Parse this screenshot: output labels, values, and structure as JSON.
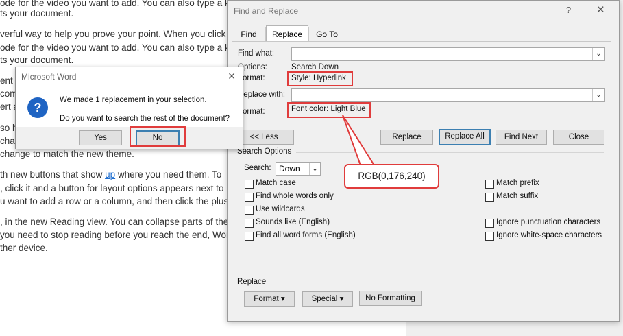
{
  "document": {
    "lines": [
      "ode for the video you want to add. You can also type a k",
      "ts your document.",
      "verful way to help you prove your point. When you click",
      "ode for the video you want to add. You can also type a k",
      "ts your document.",
      "ent",
      "com",
      "ert a",
      "so h",
      "chan",
      "change to match the new theme.",
      "th new buttons that show",
      "where you need them. To",
      ", click it and a button for layout options appears next to",
      "u want to add a row or a column, and then click the plus",
      ", in the new Reading view. You can collapse parts of the",
      "you need to stop reading before you reach the end, Wor",
      "ther device."
    ],
    "link_word": "up"
  },
  "find_replace": {
    "title": "Find and Replace",
    "help": "?",
    "close": "✕",
    "tabs": [
      "Find",
      "Replace",
      "Go To"
    ],
    "find_what_label": "Find what:",
    "find_what_value": "",
    "options_label": "Options:",
    "options_value": "Search Down",
    "format_label_1": "Format:",
    "format_value_1": "Style: Hyperlink",
    "replace_with_label": "Replace with:",
    "replace_with_value": "",
    "format_label_2": "Format:",
    "format_value_2": "Font color: Light Blue",
    "buttons": {
      "less": "<< Less",
      "replace": "Replace",
      "replace_all": "Replace All",
      "find_next": "Find Next",
      "close": "Close"
    },
    "search_options_label": "Search Options",
    "search_label": "Search:",
    "search_value": "Down",
    "checkboxes_left": [
      "Match case",
      "Find whole words only",
      "Use wildcards",
      "Sounds like (English)",
      "Find all word forms (English)"
    ],
    "checkboxes_right": [
      "Match prefix",
      "Match suffix",
      "Ignore punctuation characters",
      "Ignore white-space characters"
    ],
    "replace_section_label": "Replace",
    "format_button": "Format",
    "special_button": "Special",
    "no_formatting_button": "No Formatting"
  },
  "message_box": {
    "title": "Microsoft Word",
    "close": "✕",
    "message1": "We made 1 replacement in your selection.",
    "message2": "Do you want to search the rest of the document?",
    "yes": "Yes",
    "no": "No"
  },
  "callout": {
    "text": "RGB(0,176,240)"
  },
  "colors": {
    "highlight_red": "#e03c3c",
    "info_blue": "#1f64c3",
    "default_button_border": "#3c7fb1"
  }
}
